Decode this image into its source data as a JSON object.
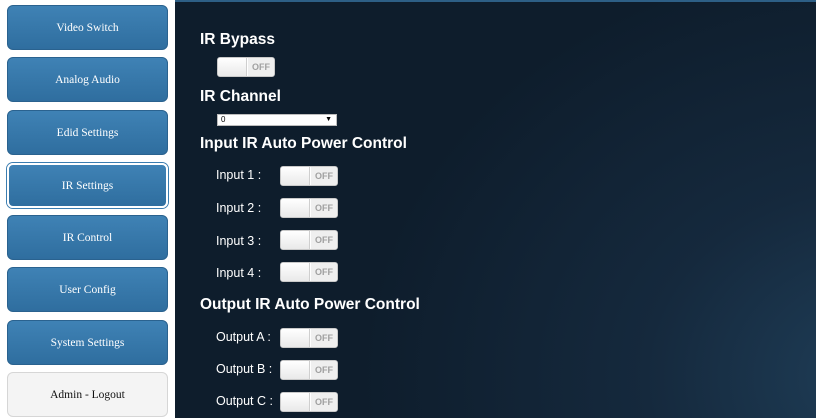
{
  "sidebar": {
    "items": [
      {
        "label": "Video Switch"
      },
      {
        "label": "Analog Audio"
      },
      {
        "label": "Edid Settings"
      },
      {
        "label": "IR Settings"
      },
      {
        "label": "IR Control"
      },
      {
        "label": "User Config"
      },
      {
        "label": "System Settings"
      },
      {
        "label": "Admin - Logout"
      }
    ]
  },
  "ir_bypass": {
    "title": "IR Bypass",
    "state": "OFF"
  },
  "ir_channel": {
    "title": "IR Channel",
    "value": "0",
    "caret": "▼"
  },
  "input_ir": {
    "title": "Input IR Auto Power Control",
    "rows": [
      {
        "label": "Input 1 :",
        "state": "OFF"
      },
      {
        "label": "Input 2 :",
        "state": "OFF"
      },
      {
        "label": "Input 3 :",
        "state": "OFF"
      },
      {
        "label": "Input 4 :",
        "state": "OFF"
      }
    ]
  },
  "output_ir": {
    "title": "Output IR Auto Power Control",
    "rows": [
      {
        "label": "Output A :",
        "state": "OFF"
      },
      {
        "label": "Output B :",
        "state": "OFF"
      },
      {
        "label": "Output C :",
        "state": "OFF"
      }
    ]
  },
  "colors": {
    "nav_button": "#3a7aad",
    "panel_background": "#15293d",
    "heading_text": "#ffffff",
    "toggle_off_text": "#a0a0a0"
  }
}
